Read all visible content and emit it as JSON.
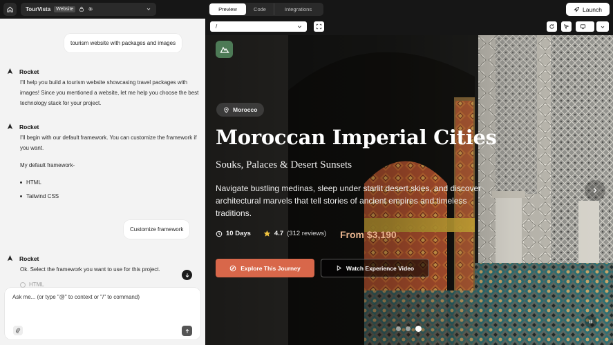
{
  "topbar": {
    "project_name": "TourVista",
    "project_badge": "Website",
    "tabs": [
      {
        "label": "Preview",
        "active": true
      },
      {
        "label": "Code",
        "active": false
      },
      {
        "label": "Integrations",
        "active": false
      }
    ],
    "launch_label": "Launch"
  },
  "chat": {
    "messages": [
      {
        "role": "user",
        "text": "tourism website with packages and images"
      },
      {
        "role": "assistant",
        "sender": "Rocket",
        "paragraphs": [
          "I'll help you build a tourism website showcasing travel packages with images! Since you mentioned a website, let me help you choose the best technology stack for your project."
        ]
      },
      {
        "role": "assistant",
        "sender": "Rocket",
        "paragraphs": [
          "I'll begin with our default framework. You can customize the framework if you want.",
          "My default framework-"
        ],
        "bullets": [
          "HTML",
          "Tailwind CSS"
        ]
      },
      {
        "role": "user",
        "text": "Customize framework"
      },
      {
        "role": "assistant",
        "sender": "Rocket",
        "paragraphs": [
          "Ok. Select the framework you want to use for this project."
        ],
        "options": [
          "HTML"
        ]
      }
    ],
    "composer_placeholder": "Ask me... (or type \"@\" to context or \"/\" to command)"
  },
  "preview": {
    "url": "/",
    "hero": {
      "location": "Morocco",
      "title": "Moroccan Imperial Cities",
      "subtitle": "Souks, Palaces & Desert Sunsets",
      "description": "Navigate bustling medinas, sleep under starlit desert skies, and discover architectural marvels that tell stories of ancient empires and timeless traditions.",
      "duration": "10 Days",
      "rating": "4.7",
      "reviews": "(312 reviews)",
      "price": "From $3,190",
      "primary_cta": "Explore This Journey",
      "secondary_cta": "Watch Experience Video",
      "slide_count": 3,
      "active_slide": 3
    }
  }
}
